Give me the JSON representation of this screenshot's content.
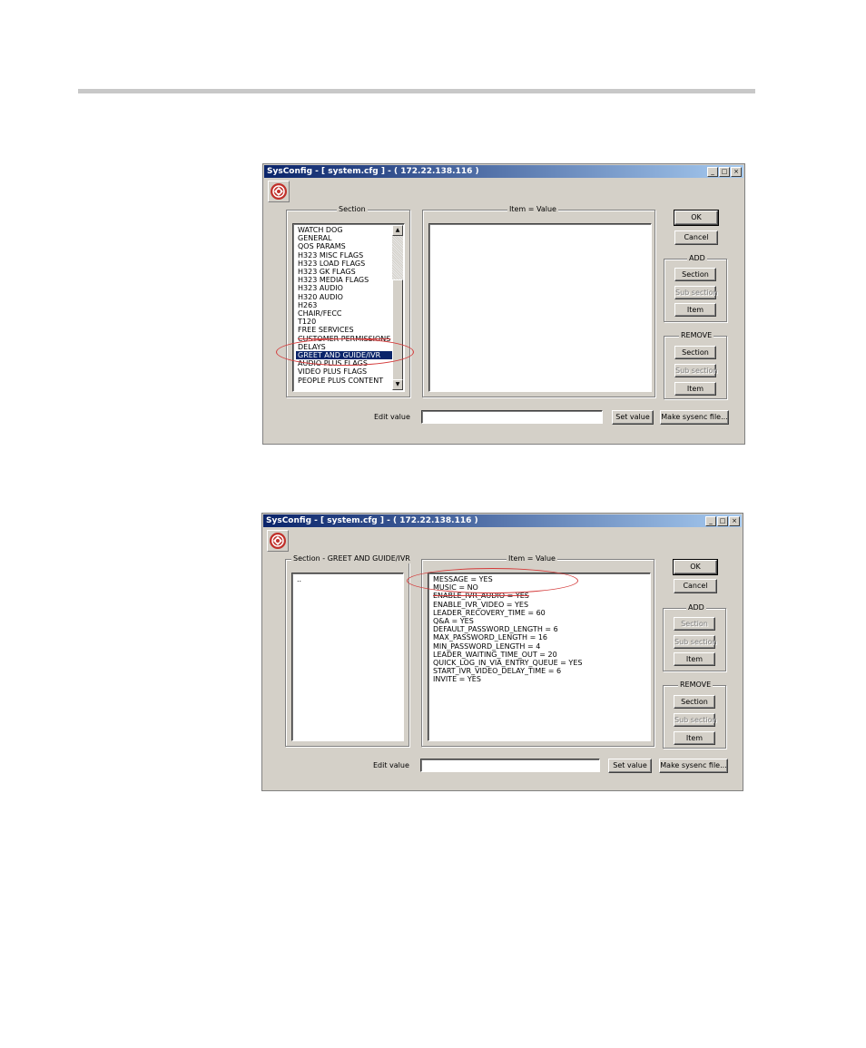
{
  "window1": {
    "title": "SysConfig - [ system.cfg ] - ( 172.22.138.116 )",
    "controls": {
      "minimize": "_",
      "maximize": "□",
      "close": "×"
    },
    "section_group_label": "Section",
    "items_group_label": "Item = Value",
    "sections": [
      "WATCH DOG",
      "GENERAL",
      "QOS PARAMS",
      "H323 MISC FLAGS",
      "H323 LOAD FLAGS",
      "H323 GK FLAGS",
      "H323 MEDIA FLAGS",
      "H323 AUDIO",
      "H320 AUDIO",
      "H263",
      "CHAIR/FECC",
      "T120",
      "FREE SERVICES",
      "CUSTOMER PERMISSIONS",
      "DELAYS",
      "GREET AND GUIDE/IVR",
      "AUDIO PLUS FLAGS",
      "VIDEO PLUS FLAGS",
      "PEOPLE PLUS CONTENT"
    ],
    "selected_section": "GREET AND GUIDE/IVR",
    "buttons": {
      "ok": "OK",
      "cancel": "Cancel",
      "set_value": "Set value",
      "make_sysenc": "Make sysenc file..."
    },
    "add_group": {
      "label": "ADD",
      "section": "Section",
      "subsection": "Sub section",
      "item": "Item"
    },
    "remove_group": {
      "label": "REMOVE",
      "section": "Section",
      "subsection": "Sub section",
      "item": "Item"
    },
    "edit_value_label": "Edit value",
    "edit_value": ""
  },
  "window2": {
    "title": "SysConfig - [ system.cfg ] - ( 172.22.138.116 )",
    "controls": {
      "minimize": "_",
      "maximize": "□",
      "close": "×"
    },
    "section_group_label": "Section - GREET AND GUIDE/IVR",
    "items_group_label": "Item = Value",
    "sections": [
      ".."
    ],
    "items": [
      "MESSAGE = YES",
      "MUSIC = NO",
      "ENABLE_IVR_AUDIO = YES",
      "ENABLE_IVR_VIDEO = YES",
      "LEADER_RECOVERY_TIME = 60",
      "Q&A = YES",
      "DEFAULT_PASSWORD_LENGTH = 6",
      "MAX_PASSWORD_LENGTH = 16",
      "MIN_PASSWORD_LENGTH = 4",
      "LEADER_WAITING_TIME_OUT = 20",
      "QUICK_LOG_IN_VIA_ENTRY_QUEUE = YES",
      "START_IVR_VIDEO_DELAY_TIME = 6",
      "INVITE = YES"
    ],
    "buttons": {
      "ok": "OK",
      "cancel": "Cancel",
      "set_value": "Set value",
      "make_sysenc": "Make sysenc file..."
    },
    "add_group": {
      "label": "ADD",
      "section": "Section",
      "subsection": "Sub section",
      "item": "Item"
    },
    "remove_group": {
      "label": "REMOVE",
      "section": "Section",
      "subsection": "Sub section",
      "item": "Item"
    },
    "edit_value_label": "Edit value",
    "edit_value": ""
  },
  "annotation_color": "#d43a3a",
  "selection_color": "#0a246a",
  "titlebar_color": "#0a246a"
}
